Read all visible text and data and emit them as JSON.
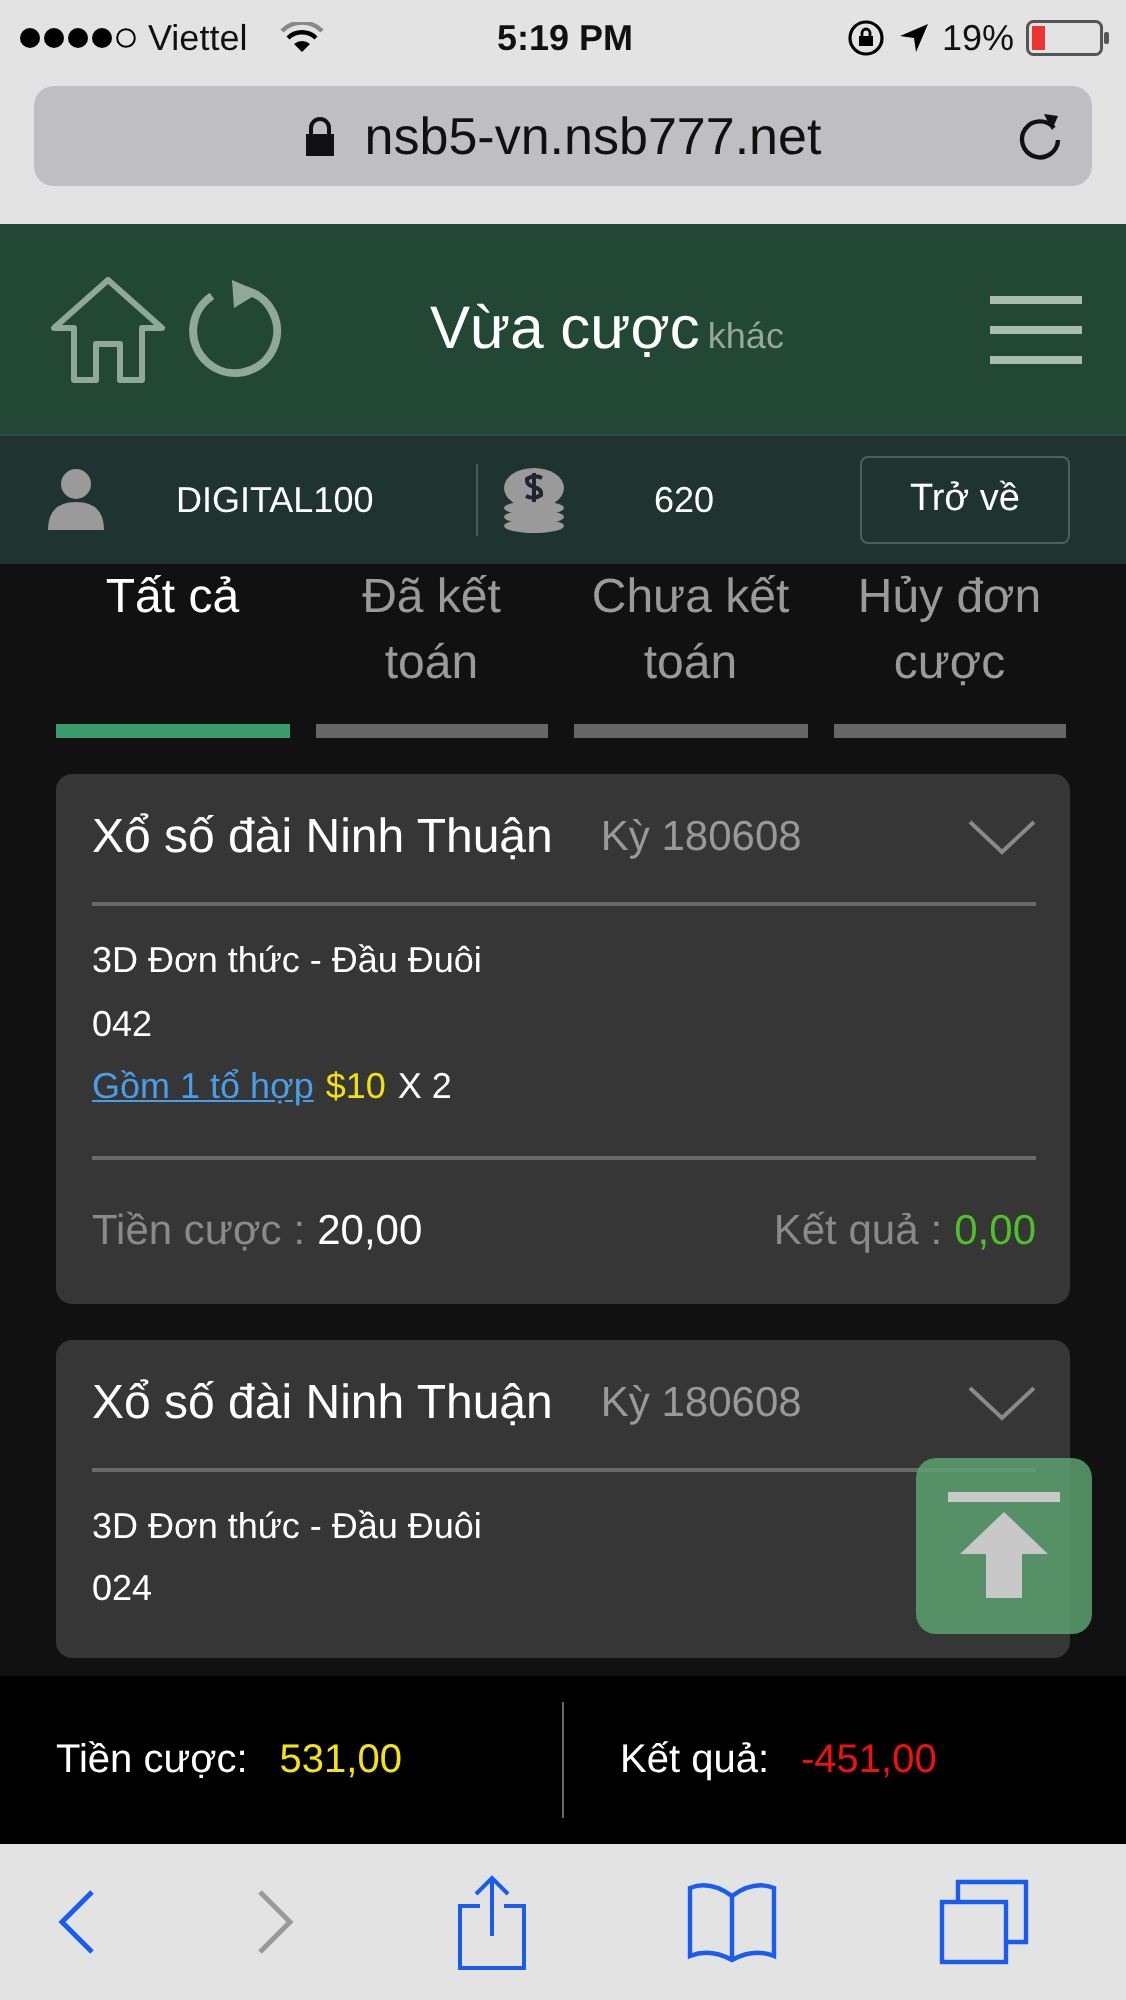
{
  "status_bar": {
    "carrier": "Viettel",
    "time": "5:19 PM",
    "battery_text": "19%"
  },
  "browser": {
    "url": "nsb5-vn.nsb777.net"
  },
  "header": {
    "title": "Vừa cược",
    "subtitle": "khác"
  },
  "account": {
    "username": "DIGITAL100",
    "balance": "620",
    "back_button": "Trở về"
  },
  "tabs": [
    {
      "label": "Tất cả",
      "selected": true
    },
    {
      "label": "Đã kết toán",
      "selected": false
    },
    {
      "label": "Chưa kết toán",
      "selected": false
    },
    {
      "label": "Hủy đơn cược",
      "selected": false
    }
  ],
  "bets": [
    {
      "title": "Xổ số đài Ninh Thuận",
      "period": "Kỳ 180608",
      "bet_type": "3D Đơn thức - Đầu Đuôi",
      "numbers": "042",
      "combo_link": "Gồm 1 tổ hợp",
      "amount": "$10",
      "multiplier": "X 2",
      "stake_label": "Tiền cược",
      "separator": ":",
      "stake": "20,00",
      "result_label": "Kết quả",
      "result": "0,00"
    },
    {
      "title": "Xổ số đài Ninh Thuận",
      "period": "Kỳ 180608",
      "bet_type": "3D Đơn thức - Đầu Đuôi",
      "numbers": "024"
    }
  ],
  "totals": {
    "stake_label": "Tiền cược:",
    "stake": "531,00",
    "result_label": "Kết quả:",
    "result": "-451,00"
  }
}
